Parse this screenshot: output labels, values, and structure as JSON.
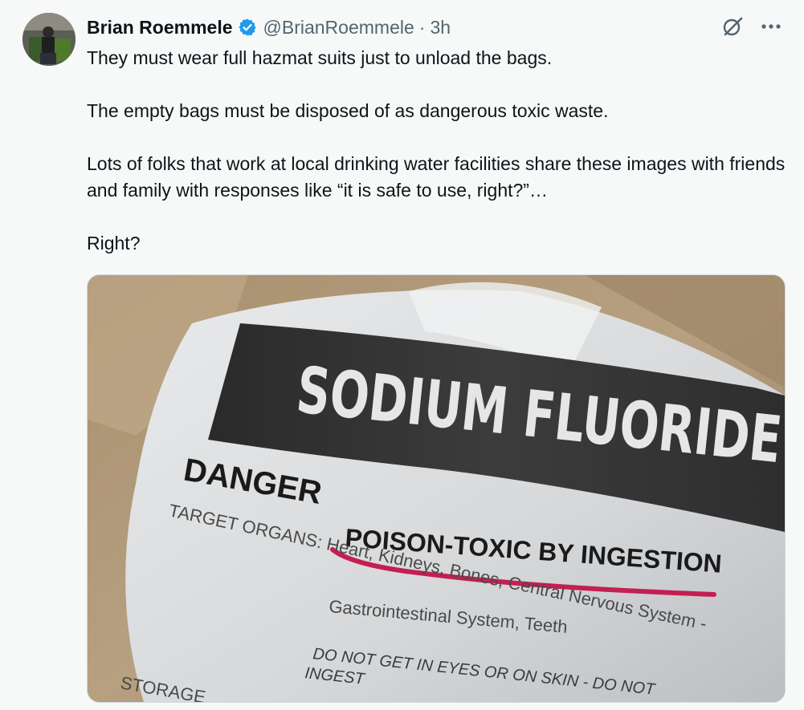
{
  "tweet": {
    "author_name": "Brian Roemmele",
    "handle": "@BrianRoemmele",
    "separator": "·",
    "time": "3h",
    "verified_color": "#1d9bf0",
    "paragraphs": [
      "They must wear full hazmat suits just to unload the bags.",
      "The empty bags must be disposed of as dangerous toxic waste.",
      "Lots of folks that work at local drinking water facilities share these images with friends and family with responses like “it is safe to use, right?”…",
      "Right?"
    ]
  },
  "media": {
    "label_title": "SODIUM FLUORIDE",
    "label_danger": "DANGER! POISON-TOXIC BY INGESTION",
    "label_danger_word": "DANGER",
    "label_toxic": "POISON-TOXIC BY INGESTION",
    "label_organs": "TARGET ORGANS: Heart, Kidneys, Bones, Central Nervous System -",
    "label_organs_2": "Gastrointestinal System, Teeth",
    "label_warning": "DO NOT GET IN EYES OR ON SKIN - DO NOT",
    "label_warning_2": "INGEST",
    "label_storage": "STORAGE",
    "underline_color": "#c41f52"
  },
  "icons": {
    "grok": "grok-icon",
    "more": "more-icon",
    "verified": "verified-badge-icon"
  }
}
